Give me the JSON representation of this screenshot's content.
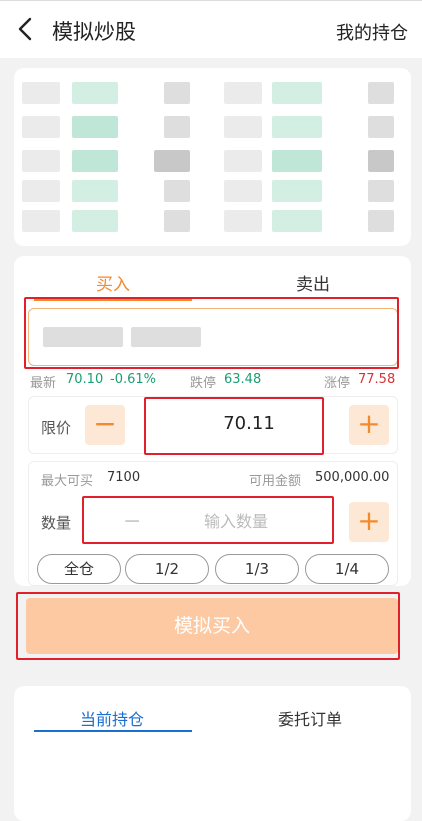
{
  "header": {
    "title": "模拟炒股",
    "holdings_link": "我的持仓"
  },
  "trade": {
    "tab_buy": "买入",
    "tab_sell": "卖出",
    "quote": {
      "latest_label": "最新",
      "latest_price": "70.10",
      "latest_change": "-0.61%",
      "limit_down_label": "跌停",
      "limit_down_value": "63.48",
      "limit_up_label": "涨停",
      "limit_up_value": "77.58"
    },
    "price": {
      "label": "限价",
      "value": "70.11",
      "minus": "−",
      "plus": "+"
    },
    "quantity": {
      "max_buy_label": "最大可买",
      "max_buy_value": "7100",
      "available_label": "可用金额",
      "available_value": "500,000.00",
      "label": "数量",
      "placeholder": "输入数量",
      "minus": "−",
      "plus": "+"
    },
    "ratios": [
      "全仓",
      "1/2",
      "1/3",
      "1/4"
    ],
    "submit_label": "模拟买入"
  },
  "bottom_tabs": {
    "current": "当前持仓",
    "orders": "委托订单"
  },
  "colors": {
    "accent_orange": "#f38a2e",
    "rise_red": "#d9323a",
    "fall_green": "#1a9e75",
    "tab_blue": "#1a6fd1",
    "highlight_box": "#e0202a"
  }
}
